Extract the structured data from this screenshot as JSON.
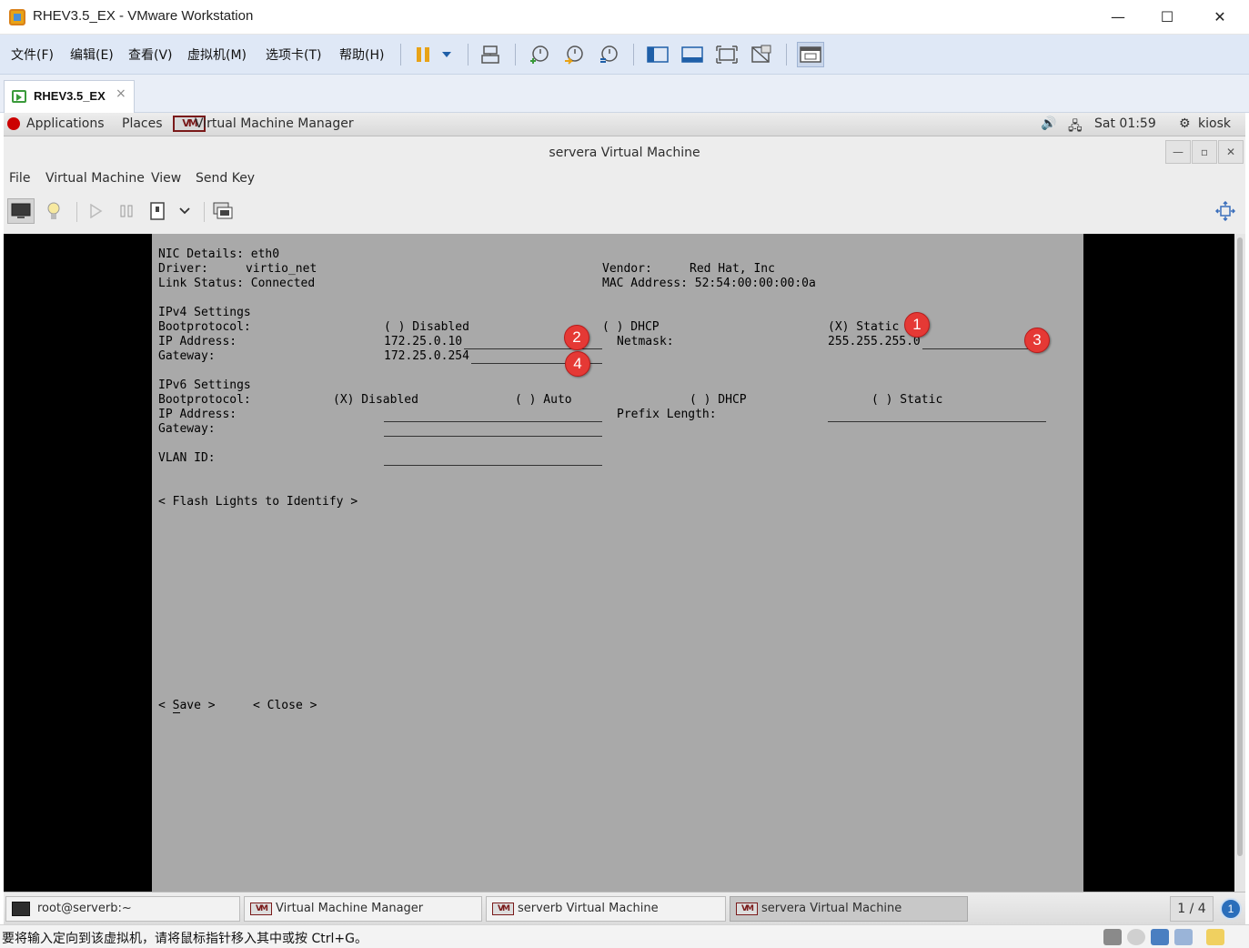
{
  "window": {
    "title": "RHEV3.5_EX - VMware Workstation",
    "minimize": "—",
    "maximize": "☐",
    "close": "✕"
  },
  "menubar": {
    "items": [
      "文件(F)",
      "编辑(E)",
      "查看(V)",
      "虚拟机(M)",
      "选项卡(T)",
      "帮助(H)"
    ]
  },
  "tabs": [
    {
      "label": "RHEV3.5_EX",
      "close": "×"
    }
  ],
  "gnome_top": {
    "applications": "Applications",
    "places": "Places",
    "vmm_app": "Virtual Machine Manager",
    "clock": "Sat 01:59",
    "user": "kiosk"
  },
  "vm_window": {
    "title": "servera Virtual Machine",
    "menu": [
      "File",
      "Virtual Machine",
      "View",
      "Send Key"
    ]
  },
  "console": {
    "nic_details": "NIC Details: eth0",
    "driver_label": "Driver:",
    "driver_value": "virtio_net",
    "link_status": "Link Status: Connected",
    "vendor_label": "Vendor:",
    "vendor_value": "Red Hat, Inc",
    "mac": "MAC Address: 52:54:00:00:00:0a",
    "ipv4_settings": "IPv4 Settings",
    "bootprotocol_label": "Bootprotocol:",
    "ipv4_disabled": "( ) Disabled",
    "ipv4_dhcp": "( ) DHCP",
    "ipv4_static": "(X) Static",
    "ip_address_label": "IP Address:",
    "ipv4_ip": "172.25.0.10",
    "netmask_label": "Netmask:",
    "ipv4_netmask": "255.255.255.0",
    "gateway_label": "Gateway:",
    "ipv4_gateway": "172.25.0.254",
    "ipv6_settings": "IPv6 Settings",
    "ipv6_bootprotocol_label": "Bootprotocol:",
    "ipv6_disabled": "(X) Disabled",
    "ipv6_auto": "( ) Auto",
    "ipv6_dhcp": "( ) DHCP",
    "ipv6_static": "( ) Static",
    "ipv6_ip_label": "IP Address:",
    "prefix_length_label": "Prefix Length:",
    "ipv6_gateway_label": "Gateway:",
    "vlan_label": "VLAN ID:",
    "flash_button": "< Flash Lights to Identify >",
    "save_button": "< Save >",
    "close_button": "< Close >"
  },
  "annotations": [
    "1",
    "2",
    "3",
    "4"
  ],
  "taskbar": {
    "tasks": [
      "root@serverb:~",
      "Virtual Machine Manager",
      "serverb Virtual Machine",
      "servera Virtual Machine"
    ],
    "workspace": "1 / 4",
    "notifications": "1"
  },
  "statusbar": {
    "message": "要将输入定向到该虚拟机，请将鼠标指针移入其中或按 Ctrl+G。"
  },
  "colors": {
    "console_bg": "#a9a9a9",
    "menubar_bg": "#dfe8f6",
    "badge": "#e53935"
  }
}
